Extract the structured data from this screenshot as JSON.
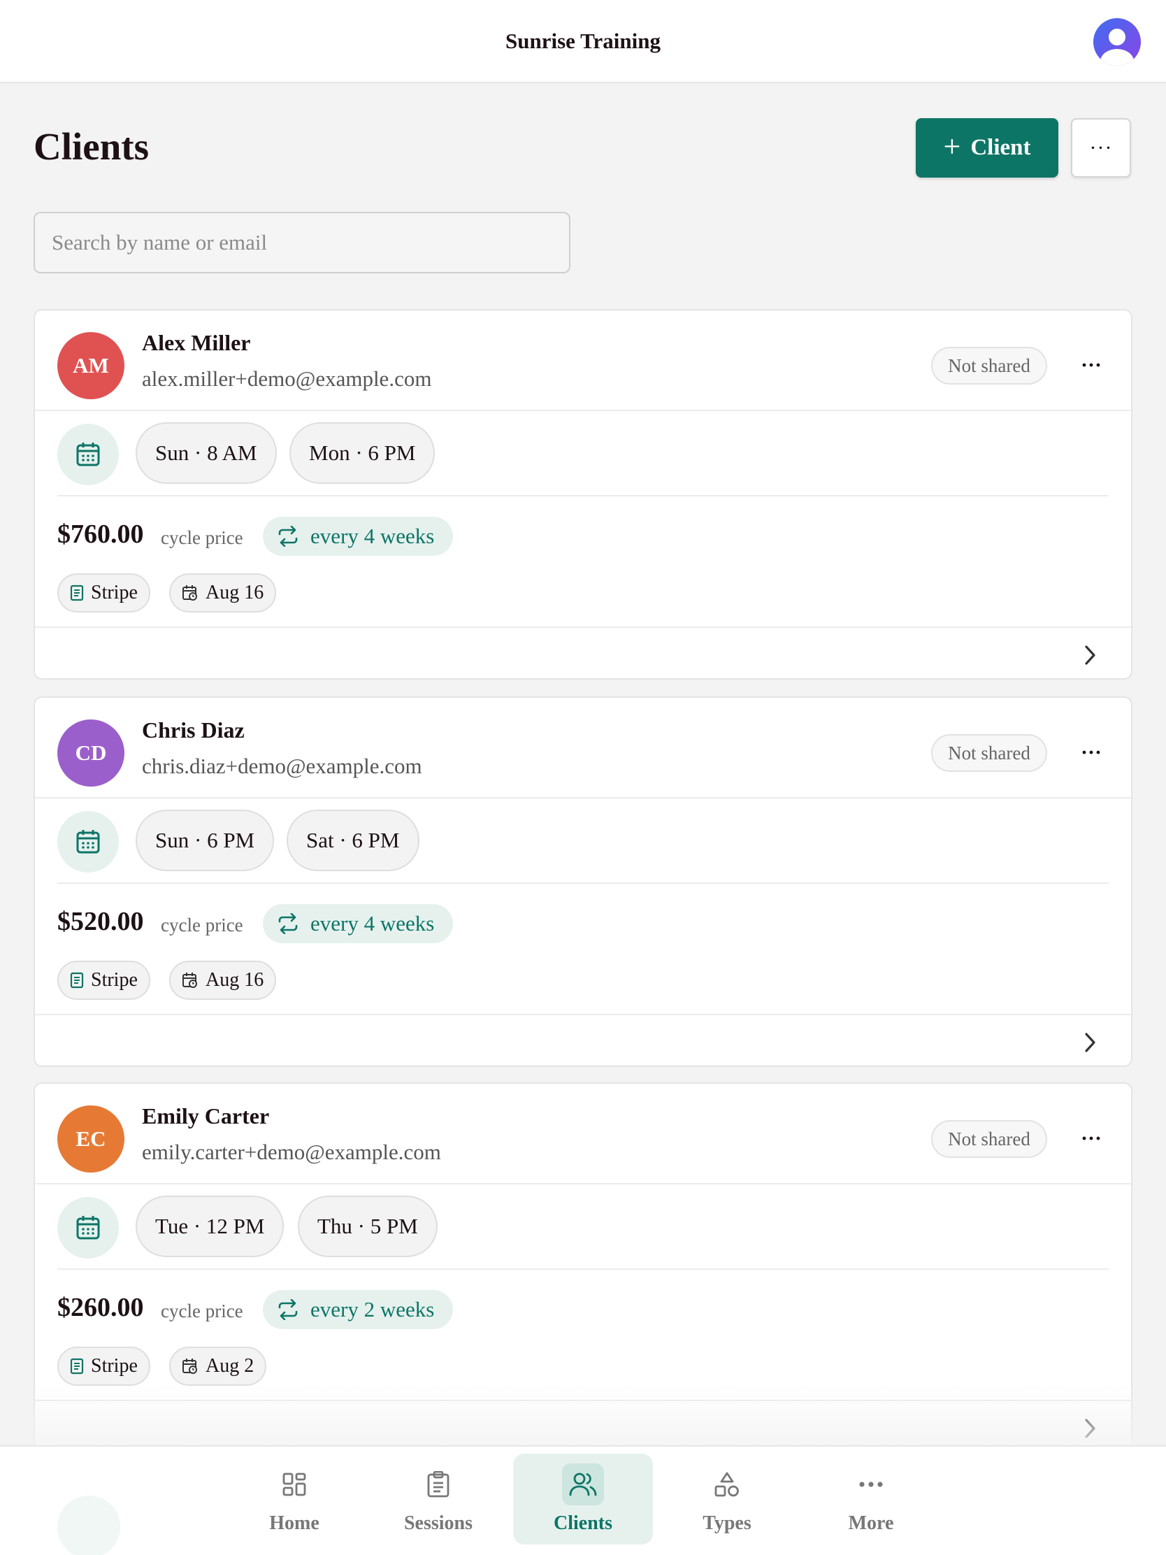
{
  "header": {
    "title": "Sunrise Training"
  },
  "page": {
    "title": "Clients",
    "add_button_label": "Client",
    "more_label": "···",
    "search_placeholder": "Search by name or email"
  },
  "clients": [
    {
      "initials": "AM",
      "avatar_color": "#e05252",
      "name": "Alex Miller",
      "email": "alex.miller+demo@example.com",
      "share_status": "Not shared",
      "slots": [
        "Sun · 8 AM",
        "Mon · 6 PM"
      ],
      "price": "$760.00",
      "price_label": "cycle price",
      "frequency": "every 4 weeks",
      "payment": "Stripe",
      "date": "Aug 16"
    },
    {
      "initials": "CD",
      "avatar_color": "#9b5fcc",
      "name": "Chris Diaz",
      "email": "chris.diaz+demo@example.com",
      "share_status": "Not shared",
      "slots": [
        "Sun · 6 PM",
        "Sat · 6 PM"
      ],
      "price": "$520.00",
      "price_label": "cycle price",
      "frequency": "every 4 weeks",
      "payment": "Stripe",
      "date": "Aug 16"
    },
    {
      "initials": "EC",
      "avatar_color": "#e67a35",
      "name": "Emily Carter",
      "email": "emily.carter+demo@example.com",
      "share_status": "Not shared",
      "slots": [
        "Tue · 12 PM",
        "Thu · 5 PM"
      ],
      "price": "$260.00",
      "price_label": "cycle price",
      "frequency": "every 2 weeks",
      "payment": "Stripe",
      "date": "Aug 2"
    }
  ],
  "nav": {
    "items": [
      {
        "label": "Home",
        "icon": "grid-icon"
      },
      {
        "label": "Sessions",
        "icon": "clipboard-icon"
      },
      {
        "label": "Clients",
        "icon": "users-icon",
        "active": true
      },
      {
        "label": "Types",
        "icon": "shapes-icon"
      },
      {
        "label": "More",
        "icon": "ellipsis-icon"
      }
    ]
  },
  "colors": {
    "accent": "#0d7566",
    "accent_light": "#e6f1ee",
    "background": "#f3f3f3"
  }
}
